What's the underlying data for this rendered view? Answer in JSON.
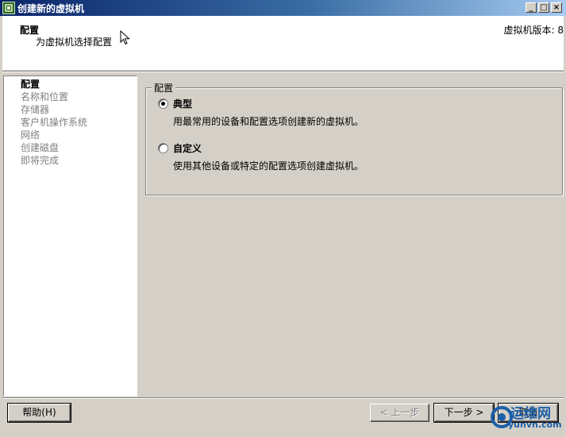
{
  "window": {
    "title": "创建新的虚拟机",
    "min_label": "_",
    "max_label": "□",
    "close_label": "×"
  },
  "header": {
    "title": "配置",
    "subtitle": "为虚拟机选择配置",
    "version": "虚拟机版本: 8"
  },
  "steps": [
    {
      "label": "配置",
      "active": true
    },
    {
      "label": "名称和位置",
      "active": false
    },
    {
      "label": "存储器",
      "active": false
    },
    {
      "label": "客户机操作系统",
      "active": false
    },
    {
      "label": "网络",
      "active": false
    },
    {
      "label": "创建磁盘",
      "active": false
    },
    {
      "label": "即将完成",
      "active": false
    }
  ],
  "config_group": {
    "legend": "配置",
    "options": [
      {
        "label": "典型",
        "description": "用最常用的设备和配置选项创建新的虚拟机。",
        "selected": true
      },
      {
        "label": "自定义",
        "description": "使用其他设备或特定的配置选项创建虚拟机。",
        "selected": false
      }
    ]
  },
  "buttons": {
    "help": "帮助(H)",
    "back": "< 上一步",
    "next": "下一步 >",
    "cancel": "取消"
  },
  "watermark": {
    "text": "运维网",
    "url": "yunvn.com"
  },
  "colors": {
    "titlebar_start": "#0a246a",
    "titlebar_end": "#a6caf0",
    "dialog_bg": "#d4d0c8",
    "watermark": "#1d5fa8"
  }
}
